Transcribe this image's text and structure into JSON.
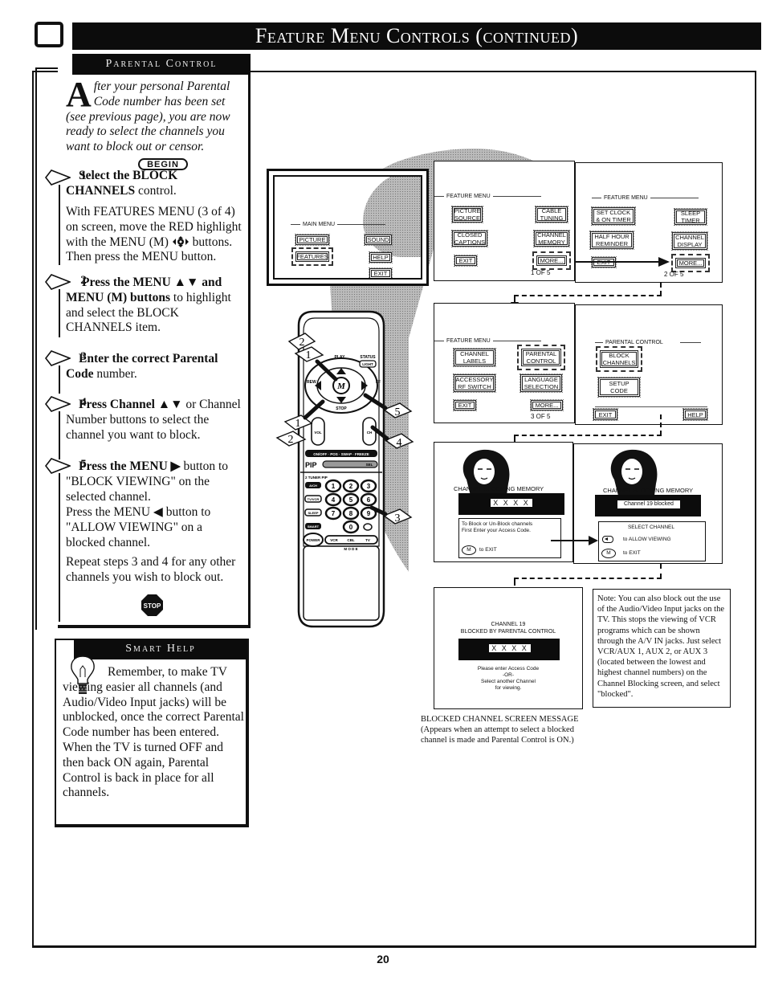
{
  "header": {
    "title": "Feature Menu Controls (continued)"
  },
  "parental_control": {
    "title": "Parental Control",
    "intro_dropcap": "A",
    "intro": "fter your personal Parental Code number has been set (see previous page), you are now ready to select the channels you want to block out or censor.",
    "begin_label": "BEGIN",
    "steps": [
      {
        "number": "1",
        "bold": "Select the BLOCK CHANNELS",
        "text": " control.",
        "detail": "With FEATURES MENU (3 of 4) on screen, move the RED highlight with the MENU (M) ",
        "detail_icon": "menu-nav-icon",
        "detail_end": " buttons. Then press the MENU button."
      },
      {
        "number": "2",
        "bold": "Press the MENU ▲▼ and MENU (M) buttons",
        "text": " to highlight and select the BLOCK CHANNELS  item."
      },
      {
        "number": "3",
        "bold": "Enter the correct Parental Code",
        "text": " number."
      },
      {
        "number": "4",
        "bold": "Press Channel ▲▼",
        "text": " or Channel Number buttons to select the channel you want to block."
      },
      {
        "number": "5",
        "bold": "Press the MENU ▶",
        "text": " button to \"BLOCK VIEWING\" on the selected channel.",
        "line2": "Press the MENU ◀ button to \"ALLOW VIEWING\" on a blocked channel.",
        "line3": "Repeat steps 3 and 4 for any other channels you wish to block out."
      }
    ],
    "stop_label": "STOP"
  },
  "smart_help": {
    "title": "Smart Help",
    "text": "Remember, to make TV viewing easier all channels (and Audio/Video Input jacks) will be unblocked, once the correct Parental Code number has been entered.",
    "text2": "When the TV is turned OFF and then back ON again, Parental Control is back in place for all channels."
  },
  "screens": {
    "main_menu": {
      "label": "MAIN MENU",
      "buttons": [
        "PICTURE",
        "FEATURES",
        "SOUND",
        "HELP",
        "EXIT"
      ],
      "highlighted": "FEATURES"
    },
    "feature_menu_1": {
      "label": "FEATURE MENU",
      "buttons": [
        "PICTURE SOURCE",
        "CLOSED CAPTIONS",
        "EXIT",
        "CABLE TUNING",
        "CHANNEL MEMORY",
        "MORE..."
      ],
      "highlighted": "MORE...",
      "page": "1 OF 5"
    },
    "feature_menu_2": {
      "label": "FEATURE MENU",
      "buttons": [
        "SET CLOCK & ON TIMER",
        "HALF HOUR REMINDER",
        "EXIT",
        "SLEEP TIMER",
        "CHANNEL DISPLAY",
        "MORE..."
      ],
      "highlighted": "MORE...",
      "page": "2 OF 5"
    },
    "feature_menu_3": {
      "label": "FEATURE MENU",
      "buttons": [
        "CHANNEL LABELS",
        "ACCESSORY RF SWITCH",
        "EXIT",
        "PARENTAL CONTROL",
        "LANGUAGE SELECTION",
        "MORE..."
      ],
      "highlighted": "PARENTAL CONTROL",
      "page": "3 OF 5"
    },
    "parental_menu": {
      "label": "PARENTAL CONTROL",
      "buttons": [
        "BLOCK CHANNELS",
        "SETUP CODE",
        "EXIT",
        "HELP"
      ],
      "highlighted": "BLOCK CHANNELS"
    },
    "blocking_memory_1": {
      "title": "CHANNEL BLOCKING MEMORY",
      "field": "X X X X",
      "info": "To Block or Un-Block channels First Enter your Access Code.",
      "exit_key": "M",
      "exit_label": "to EXIT"
    },
    "blocking_memory_2": {
      "title": "CHANNEL BLOCKING MEMORY",
      "field": "Channel 19 blocked",
      "select_label": "SELECT CHANNEL",
      "allow_label": "to ALLOW VIEWING",
      "exit_key": "M",
      "exit_label": "to EXIT"
    },
    "blocked_message": {
      "line1": "CHANNEL 19",
      "line2": "BLOCKED BY PARENTAL CONTROL",
      "field": "X X X X",
      "prompt1": "Please enter Access Code",
      "prompt_or": "-OR-",
      "prompt2": "Select another Channel",
      "prompt3": "for viewing."
    }
  },
  "caption": {
    "title": "BLOCKED CHANNEL SCREEN MESSAGE",
    "text": "(Appears when an attempt to select a blocked channel is made and Parental Control is ON.)"
  },
  "note": {
    "text": "Note: You can also block out  the use of the Audio/Video Input jacks on the TV. This stops the viewing of VCR programs which can be shown through the A/V IN jacks. Just select VCR/AUX 1, AUX 2, or AUX 3 (located between the lowest and highest channel numbers) on the Channel Blocking screen, and select \"blocked\"."
  },
  "remote": {
    "callouts": [
      "2",
      "1",
      "1",
      "2",
      "5",
      "4",
      "3"
    ],
    "labels": {
      "play": "PLAY",
      "status": "STATUS",
      "light": "LIGHT",
      "rew": "REW",
      "ff": "FF",
      "stop": "STOP",
      "menu": "M",
      "vol": "VOL",
      "ch": "CH",
      "pip_row": [
        "ON/OFF",
        "POS",
        "SWAP",
        "FREEZE"
      ],
      "pip": "PIP",
      "pip_sel": "SEL",
      "tuner": "2 TUNER PIP",
      "keys": [
        "1",
        "2",
        "3",
        "4",
        "5",
        "6",
        "7",
        "8",
        "9",
        "0"
      ],
      "side_keys": [
        "A/CH",
        "TV/VCR",
        "SLEEP",
        "SMART"
      ],
      "power": "POWER",
      "mode_keys": [
        "VCR",
        "CBL",
        "TV"
      ],
      "mode": "M O D E"
    }
  },
  "page_number": "20"
}
